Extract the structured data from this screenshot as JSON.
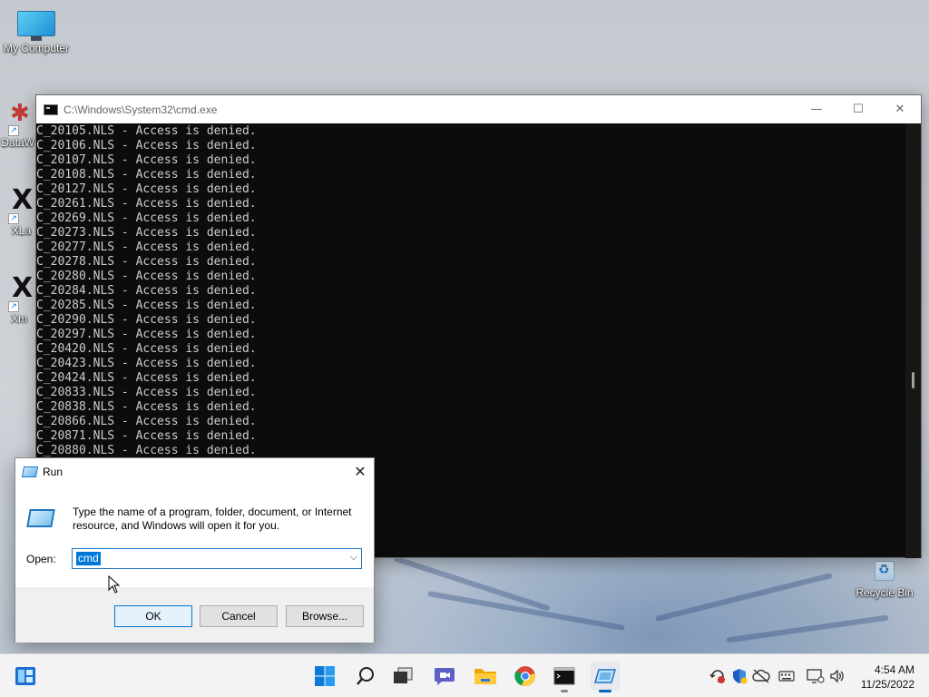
{
  "desktop": {
    "icons": [
      {
        "label": "My Computer"
      },
      {
        "label": "DataW"
      },
      {
        "label": "XLa"
      },
      {
        "label": "Xm"
      },
      {
        "label": "Recycle Bin"
      }
    ]
  },
  "cmd_window": {
    "title": "C:\\Windows\\System32\\cmd.exe",
    "lines": [
      "C_20105.NLS - Access is denied.",
      "C_20106.NLS - Access is denied.",
      "C_20107.NLS - Access is denied.",
      "C_20108.NLS - Access is denied.",
      "C_20127.NLS - Access is denied.",
      "C_20261.NLS - Access is denied.",
      "C_20269.NLS - Access is denied.",
      "C_20273.NLS - Access is denied.",
      "C_20277.NLS - Access is denied.",
      "C_20278.NLS - Access is denied.",
      "C_20280.NLS - Access is denied.",
      "C_20284.NLS - Access is denied.",
      "C_20285.NLS - Access is denied.",
      "C_20290.NLS - Access is denied.",
      "C_20297.NLS - Access is denied.",
      "C_20420.NLS - Access is denied.",
      "C_20423.NLS - Access is denied.",
      "C_20424.NLS - Access is denied.",
      "C_20833.NLS - Access is denied.",
      "C_20838.NLS - Access is denied.",
      "C_20866.NLS - Access is denied.",
      "C_20871.NLS - Access is denied.",
      "C_20880.NLS - Access is denied."
    ],
    "minimize_glyph": "—",
    "maximize_glyph": "☐",
    "close_glyph": "✕"
  },
  "run_dialog": {
    "title": "Run",
    "close_glyph": "✕",
    "description": "Type the name of a program, folder, document, or Internet resource, and Windows will open it for you.",
    "open_label": "Open:",
    "open_value": "cmd",
    "dropdown_glyph": "⌵",
    "ok_label": "OK",
    "cancel_label": "Cancel",
    "browse_label": "Browse..."
  },
  "taskbar": {
    "items": [
      "widgets-icon",
      "start-icon",
      "search-icon",
      "task-view-icon",
      "chat-icon",
      "file-explorer-icon",
      "chrome-icon",
      "cmd-taskbar-icon",
      "run-taskbar-icon"
    ],
    "tray": [
      "network-alert-icon",
      "security-shield-icon",
      "cloud-off-icon",
      "keyboard-icon",
      "display-icon",
      "volume-icon"
    ],
    "time": "4:54 AM",
    "date": "11/25/2022"
  },
  "colors": {
    "accent": "#0078d7",
    "console_bg": "#0c0c0c",
    "console_fg": "#cccccc",
    "taskbar_bg": "#f3f3f3"
  }
}
